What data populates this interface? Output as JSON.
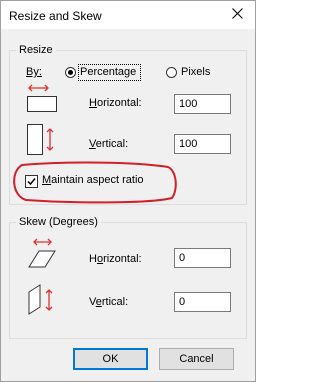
{
  "window": {
    "title": "Resize and Skew"
  },
  "resize": {
    "group_label": "Resize",
    "by_label": "By:",
    "option_percentage": "Percentage",
    "option_pixels": "Pixels",
    "selected": "Percentage",
    "horizontal_label": "Horizontal:",
    "horizontal_value": "100",
    "vertical_label": "Vertical:",
    "vertical_value": "100",
    "maintain_label": "Maintain aspect ratio",
    "maintain_checked": true
  },
  "skew": {
    "group_label": "Skew (Degrees)",
    "horizontal_label": "Horizontal:",
    "horizontal_value": "0",
    "vertical_label": "Vertical:",
    "vertical_value": "0"
  },
  "buttons": {
    "ok": "OK",
    "cancel": "Cancel"
  },
  "colors": {
    "annotation": "#d0202a",
    "accent": "#0078d7",
    "arrow": "#e03030"
  }
}
